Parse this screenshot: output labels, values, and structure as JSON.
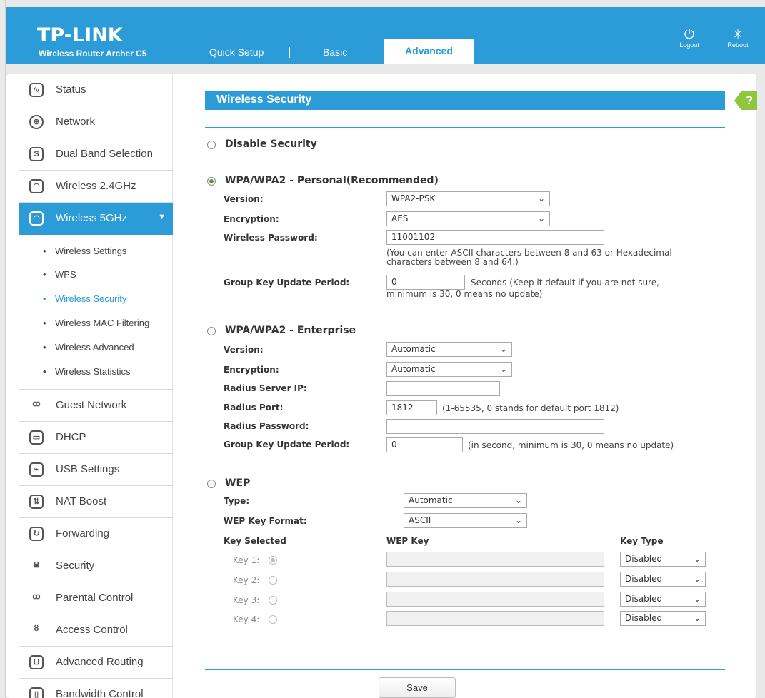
{
  "header": {
    "brand": "TP-LINK",
    "model": "Wireless Router Archer C5",
    "tabs": [
      "Quick Setup",
      "Basic",
      "Advanced"
    ],
    "logout_label": "Logout",
    "reboot_label": "Reboot"
  },
  "sidebar": {
    "items_top": [
      "Status",
      "Network",
      "Dual Band Selection",
      "Wireless 2.4GHz",
      "Wireless 5GHz"
    ],
    "subitems": [
      "Wireless Settings",
      "WPS",
      "Wireless Security",
      "Wireless MAC Filtering",
      "Wireless Advanced",
      "Wireless Statistics"
    ],
    "items_bottom": [
      "Guest Network",
      "DHCP",
      "USB Settings",
      "NAT Boost",
      "Forwarding",
      "Security",
      "Parental Control",
      "Access Control",
      "Advanced Routing",
      "Bandwidth Control"
    ]
  },
  "page": {
    "title": "Wireless Security",
    "disable": {
      "label": "Disable Security"
    },
    "personal": {
      "label": "WPA/WPA2 - Personal(Recommended)",
      "version_label": "Version:",
      "version_value": "WPA2-PSK",
      "encryption_label": "Encryption:",
      "encryption_value": "AES",
      "password_label": "Wireless Password:",
      "password_value": "11001102",
      "password_note": "(You can enter ASCII characters between 8 and 63 or Hexadecimal characters between 8 and 64.)",
      "gkup_label": "Group Key Update Period:",
      "gkup_value": "0",
      "gkup_note_1": "Seconds (Keep it default if you are not sure,",
      "gkup_note_2": "minimum is 30, 0 means no update)"
    },
    "enterprise": {
      "label": "WPA/WPA2 - Enterprise",
      "version_label": "Version:",
      "version_value": "Automatic",
      "encryption_label": "Encryption:",
      "encryption_value": "Automatic",
      "radius_ip_label": "Radius Server IP:",
      "radius_ip_value": "",
      "radius_port_label": "Radius Port:",
      "radius_port_value": "1812",
      "radius_port_note": "(1-65535, 0 stands for default port 1812)",
      "radius_pw_label": "Radius Password:",
      "radius_pw_value": "",
      "gkup_label": "Group Key Update Period:",
      "gkup_value": "0",
      "gkup_note": "(in second, minimum is 30, 0 means no update)"
    },
    "wep": {
      "label": "WEP",
      "type_label": "Type:",
      "type_value": "Automatic",
      "format_label": "WEP Key Format:",
      "format_value": "ASCII",
      "col_key_selected": "Key Selected",
      "col_wep_key": "WEP Key",
      "col_key_type": "Key Type",
      "keys": [
        {
          "label": "Key 1:",
          "value": "",
          "type": "Disabled"
        },
        {
          "label": "Key 2:",
          "value": "",
          "type": "Disabled"
        },
        {
          "label": "Key 3:",
          "value": "",
          "type": "Disabled"
        },
        {
          "label": "Key 4:",
          "value": "",
          "type": "Disabled"
        }
      ]
    },
    "save_label": "Save"
  },
  "colors": {
    "accent": "#2b9cd8",
    "help": "#8ec63f"
  }
}
